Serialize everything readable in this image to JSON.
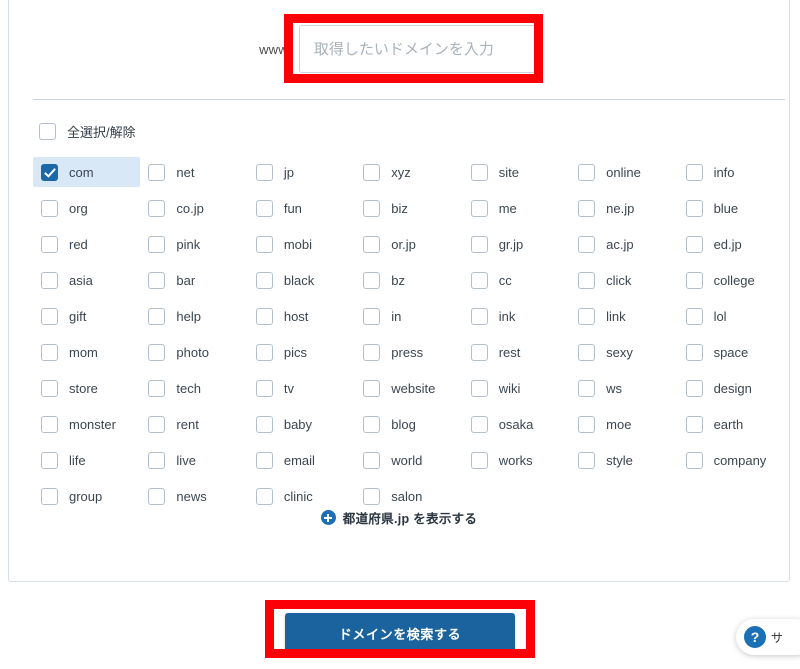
{
  "search": {
    "prefix_label": "www.",
    "input_placeholder": "取得したいドメインを入力",
    "input_value": ""
  },
  "select_all": {
    "label": "全選択/解除",
    "checked": false
  },
  "tld_grid": {
    "columns": 7,
    "items": [
      {
        "label": "com",
        "checked": true
      },
      {
        "label": "net",
        "checked": false
      },
      {
        "label": "jp",
        "checked": false
      },
      {
        "label": "xyz",
        "checked": false
      },
      {
        "label": "site",
        "checked": false
      },
      {
        "label": "online",
        "checked": false
      },
      {
        "label": "info",
        "checked": false
      },
      {
        "label": "org",
        "checked": false
      },
      {
        "label": "co.jp",
        "checked": false
      },
      {
        "label": "fun",
        "checked": false
      },
      {
        "label": "biz",
        "checked": false
      },
      {
        "label": "me",
        "checked": false
      },
      {
        "label": "ne.jp",
        "checked": false
      },
      {
        "label": "blue",
        "checked": false
      },
      {
        "label": "red",
        "checked": false
      },
      {
        "label": "pink",
        "checked": false
      },
      {
        "label": "mobi",
        "checked": false
      },
      {
        "label": "or.jp",
        "checked": false
      },
      {
        "label": "gr.jp",
        "checked": false
      },
      {
        "label": "ac.jp",
        "checked": false
      },
      {
        "label": "ed.jp",
        "checked": false
      },
      {
        "label": "asia",
        "checked": false
      },
      {
        "label": "bar",
        "checked": false
      },
      {
        "label": "black",
        "checked": false
      },
      {
        "label": "bz",
        "checked": false
      },
      {
        "label": "cc",
        "checked": false
      },
      {
        "label": "click",
        "checked": false
      },
      {
        "label": "college",
        "checked": false
      },
      {
        "label": "gift",
        "checked": false
      },
      {
        "label": "help",
        "checked": false
      },
      {
        "label": "host",
        "checked": false
      },
      {
        "label": "in",
        "checked": false
      },
      {
        "label": "ink",
        "checked": false
      },
      {
        "label": "link",
        "checked": false
      },
      {
        "label": "lol",
        "checked": false
      },
      {
        "label": "mom",
        "checked": false
      },
      {
        "label": "photo",
        "checked": false
      },
      {
        "label": "pics",
        "checked": false
      },
      {
        "label": "press",
        "checked": false
      },
      {
        "label": "rest",
        "checked": false
      },
      {
        "label": "sexy",
        "checked": false
      },
      {
        "label": "space",
        "checked": false
      },
      {
        "label": "store",
        "checked": false
      },
      {
        "label": "tech",
        "checked": false
      },
      {
        "label": "tv",
        "checked": false
      },
      {
        "label": "website",
        "checked": false
      },
      {
        "label": "wiki",
        "checked": false
      },
      {
        "label": "ws",
        "checked": false
      },
      {
        "label": "design",
        "checked": false
      },
      {
        "label": "monster",
        "checked": false
      },
      {
        "label": "rent",
        "checked": false
      },
      {
        "label": "baby",
        "checked": false
      },
      {
        "label": "blog",
        "checked": false
      },
      {
        "label": "osaka",
        "checked": false
      },
      {
        "label": "moe",
        "checked": false
      },
      {
        "label": "earth",
        "checked": false
      },
      {
        "label": "life",
        "checked": false
      },
      {
        "label": "live",
        "checked": false
      },
      {
        "label": "email",
        "checked": false
      },
      {
        "label": "world",
        "checked": false
      },
      {
        "label": "works",
        "checked": false
      },
      {
        "label": "style",
        "checked": false
      },
      {
        "label": "company",
        "checked": false
      },
      {
        "label": "group",
        "checked": false
      },
      {
        "label": "news",
        "checked": false
      },
      {
        "label": "clinic",
        "checked": false
      },
      {
        "label": "salon",
        "checked": false
      },
      {
        "label": "",
        "checked": false,
        "empty": true
      },
      {
        "label": "",
        "checked": false,
        "empty": true
      },
      {
        "label": "",
        "checked": false,
        "empty": true
      }
    ]
  },
  "expand": {
    "label": "都道府県.jp を表示する",
    "icon": "plus-circle-icon"
  },
  "submit": {
    "label": "ドメインを検索する"
  },
  "help_widget": {
    "icon": "question-mark-icon",
    "icon_glyph": "?",
    "label": "サ"
  },
  "annotations": {
    "input_highlight_color": "#fb0007",
    "button_highlight_color": "#fb0007"
  },
  "colors": {
    "accent_blue": "#1b639e",
    "selected_row_bg": "#d8e8f7",
    "checkbox_checked": "#1b68a8",
    "card_border": "#d7dfe6"
  }
}
